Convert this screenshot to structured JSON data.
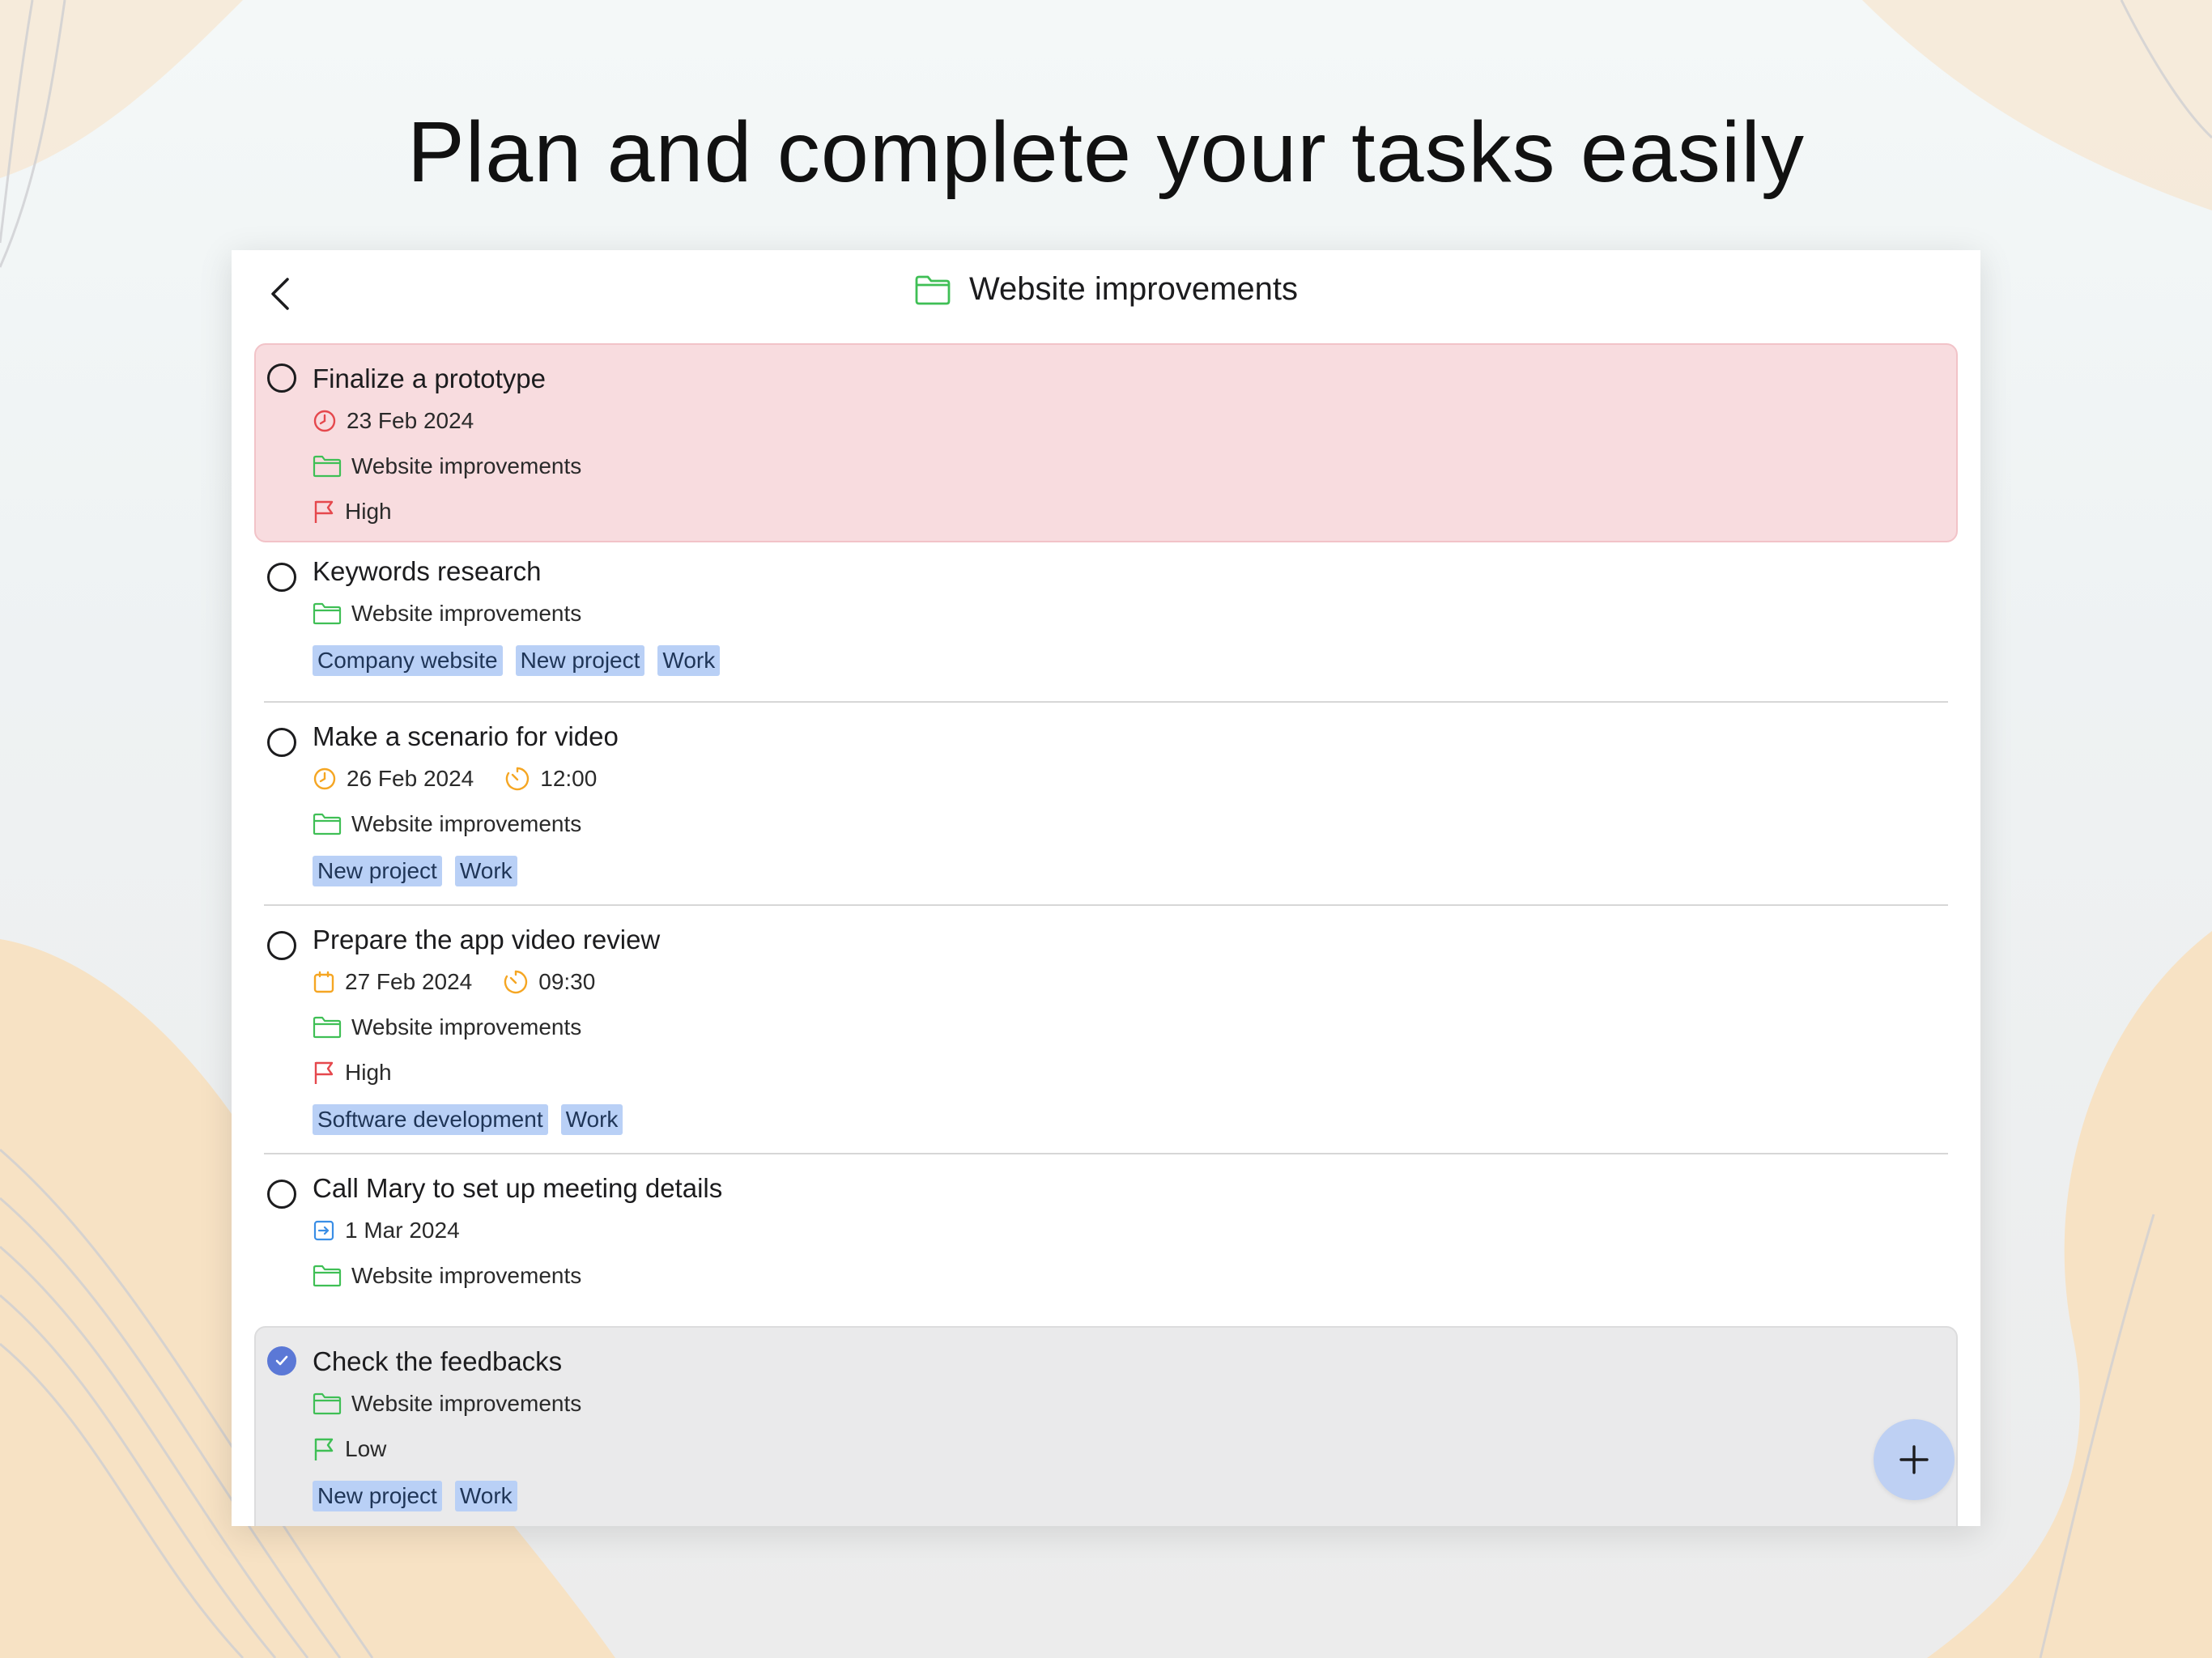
{
  "headline": "Plan and complete your tasks easily",
  "header": {
    "title": "Website improvements",
    "back_icon": "chevron-left-icon",
    "folder_icon": "folder-icon"
  },
  "colors": {
    "folder_green": "#3fbf55",
    "flag_red": "#e5484d",
    "flag_green": "#3fbf55",
    "clock_orange": "#f5a623",
    "overdue_red": "#e5484d",
    "due_blue": "#3a8ee6",
    "tag_bg": "#b9d0f6",
    "check_blue": "#5b78d6",
    "fab_bg": "#bed0f3"
  },
  "tasks": [
    {
      "title": "Finalize a prototype",
      "date": "23 Feb 2024",
      "project": "Website improvements",
      "priority": "High"
    },
    {
      "title": "Keywords research",
      "project": "Website improvements",
      "tags": [
        "Company website",
        "New project",
        "Work"
      ]
    },
    {
      "title": "Make a scenario for video",
      "date": "26 Feb 2024",
      "time": "12:00",
      "project": "Website improvements",
      "tags": [
        "New project",
        "Work"
      ]
    },
    {
      "title": "Prepare the app video review",
      "date": "27 Feb 2024",
      "time": "09:30",
      "project": "Website improvements",
      "priority": "High",
      "tags": [
        "Software development",
        "Work"
      ]
    },
    {
      "title": "Call Mary to set up meeting details",
      "date": "1 Mar 2024",
      "project": "Website improvements"
    },
    {
      "title": "Check the feedbacks",
      "project": "Website improvements",
      "priority": "Low",
      "tags": [
        "New project",
        "Work"
      ],
      "completed": true
    }
  ],
  "fab_icon": "plus-icon"
}
